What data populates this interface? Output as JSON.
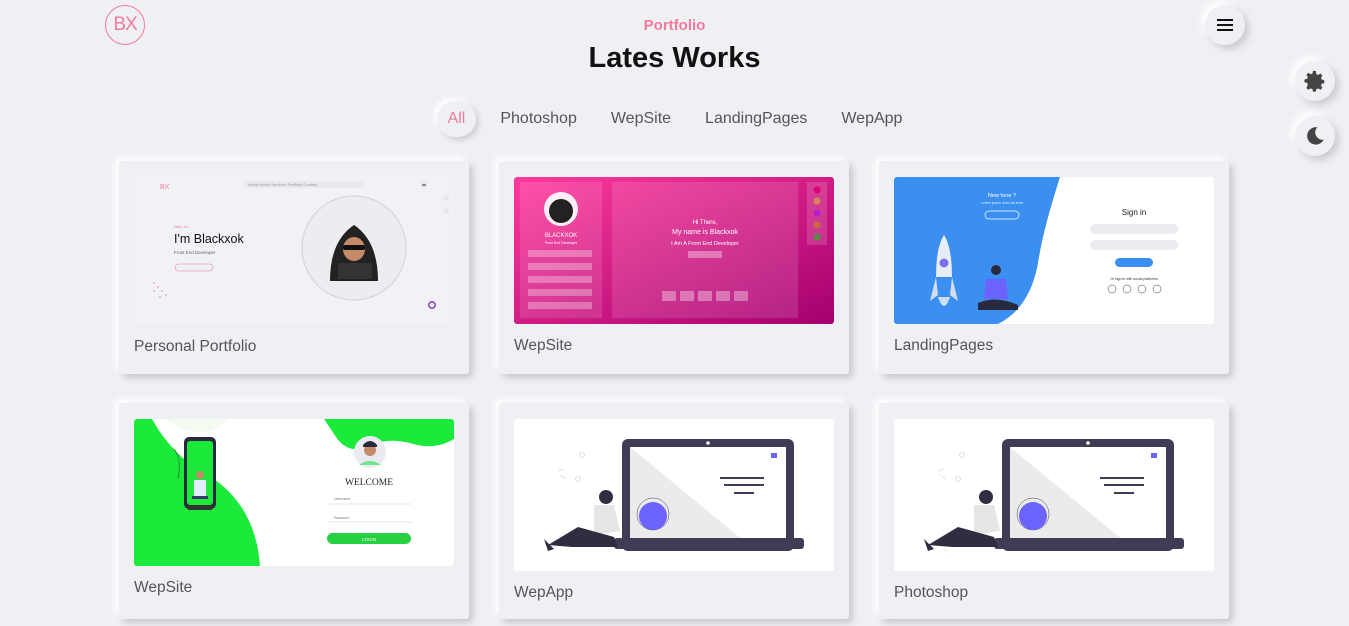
{
  "header": {
    "logo_text": "BX",
    "subtitle": "Portfolio",
    "title": "Lates Works"
  },
  "filters": [
    {
      "label": "All",
      "active": true
    },
    {
      "label": "Photoshop",
      "active": false
    },
    {
      "label": "WepSite",
      "active": false
    },
    {
      "label": "LandingPages",
      "active": false
    },
    {
      "label": "WepApp",
      "active": false
    }
  ],
  "projects": [
    {
      "title": "Personal Portfolio",
      "thumb": {
        "heading": "I'm Blackxok",
        "role": "Front End Developer"
      }
    },
    {
      "title": "WepSite",
      "thumb": {
        "name": "BLACKXOK",
        "headline": "My name is Blackxok"
      }
    },
    {
      "title": "LandingPages",
      "thumb": {
        "heading": "Sign in",
        "left_heading": "New here ?"
      }
    },
    {
      "title": "WepSite",
      "thumb": {
        "heading": "WELCOME",
        "button": "LOGIN"
      }
    },
    {
      "title": "WepApp"
    },
    {
      "title": "Photoshop"
    }
  ],
  "colors": {
    "accent": "#f27a9a",
    "background": "#eff0f4"
  },
  "icons": [
    "menu-icon",
    "gear-icon",
    "moon-icon"
  ]
}
